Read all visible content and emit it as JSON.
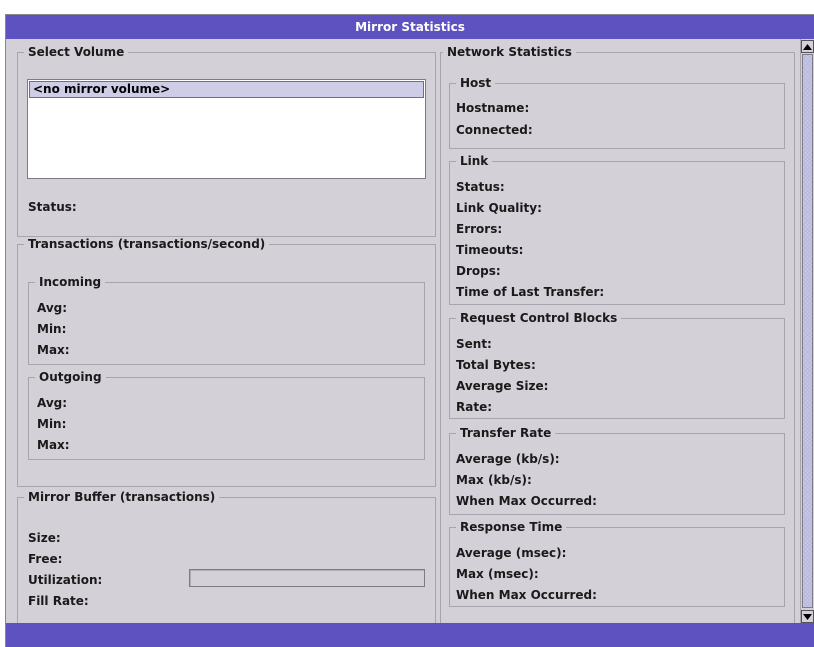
{
  "window": {
    "title": "Mirror Statistics"
  },
  "select_volume": {
    "legend": "Select Volume",
    "items": [
      "<no mirror volume>"
    ],
    "status_label": "Status:"
  },
  "transactions": {
    "legend": "Transactions (transactions/second)",
    "incoming": {
      "legend": "Incoming",
      "avg": "Avg:",
      "min": "Min:",
      "max": "Max:"
    },
    "outgoing": {
      "legend": "Outgoing",
      "avg": "Avg:",
      "min": "Min:",
      "max": "Max:"
    }
  },
  "mirror_buffer": {
    "legend": "Mirror Buffer (transactions)",
    "size": "Size:",
    "free": "Free:",
    "utilization": "Utilization:",
    "fill_rate": "Fill Rate:",
    "utilization_level": 0
  },
  "network": {
    "legend": "Network Statistics",
    "host": {
      "legend": "Host",
      "hostname": "Hostname:",
      "connected": "Connected:"
    },
    "link": {
      "legend": "Link",
      "status": "Status:",
      "quality": "Link Quality:",
      "errors": "Errors:",
      "timeouts": "Timeouts:",
      "drops": "Drops:",
      "last_transfer": "Time of Last Transfer:"
    },
    "rcb": {
      "legend": "Request Control Blocks",
      "sent": "Sent:",
      "total_bytes": "Total Bytes:",
      "average_size": "Average Size:",
      "rate": "Rate:"
    },
    "transfer_rate": {
      "legend": "Transfer Rate",
      "average": "Average (kb/s):",
      "max": "Max (kb/s):",
      "when_max": "When Max Occurred:"
    },
    "response_time": {
      "legend": "Response Time",
      "average": "Average (msec):",
      "max": "Max (msec):",
      "when_max": "When Max Occurred:"
    }
  },
  "colors": {
    "title_bar": "#5d52c0",
    "panel": "#d4d0d8",
    "selection": "#cfcce8"
  },
  "icons": {
    "scroll_up": "arrow-up",
    "scroll_down": "arrow-down"
  }
}
